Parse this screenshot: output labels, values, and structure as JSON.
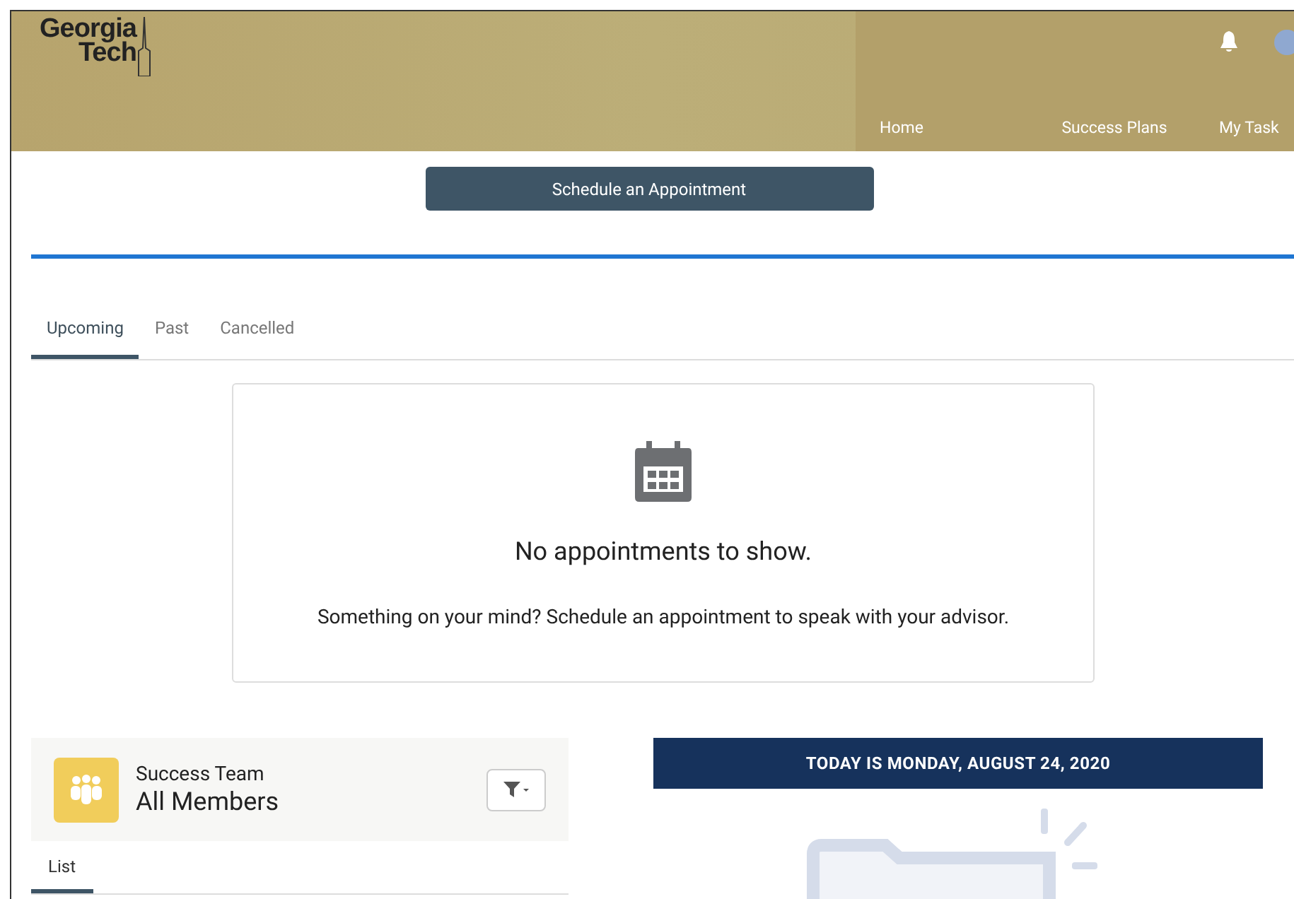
{
  "header": {
    "logo": [
      "Georgia",
      "Tech"
    ],
    "nav": [
      {
        "label": "Home"
      },
      {
        "label": "Success Plans"
      },
      {
        "label": "My Task"
      }
    ]
  },
  "schedule_button": "Schedule an Appointment",
  "tabs": [
    {
      "label": "Upcoming",
      "selected": true
    },
    {
      "label": "Past",
      "selected": false
    },
    {
      "label": "Cancelled",
      "selected": false
    }
  ],
  "empty_state": {
    "title": "No appointments to show.",
    "message": "Something on your mind? Schedule an appointment to speak with your advisor."
  },
  "success_team": {
    "title": "Success Team",
    "subtitle": "All Members",
    "tabs": [
      {
        "label": "List",
        "selected": true
      }
    ]
  },
  "date_banner": "TODAY IS MONDAY, AUGUST 24, 2020"
}
